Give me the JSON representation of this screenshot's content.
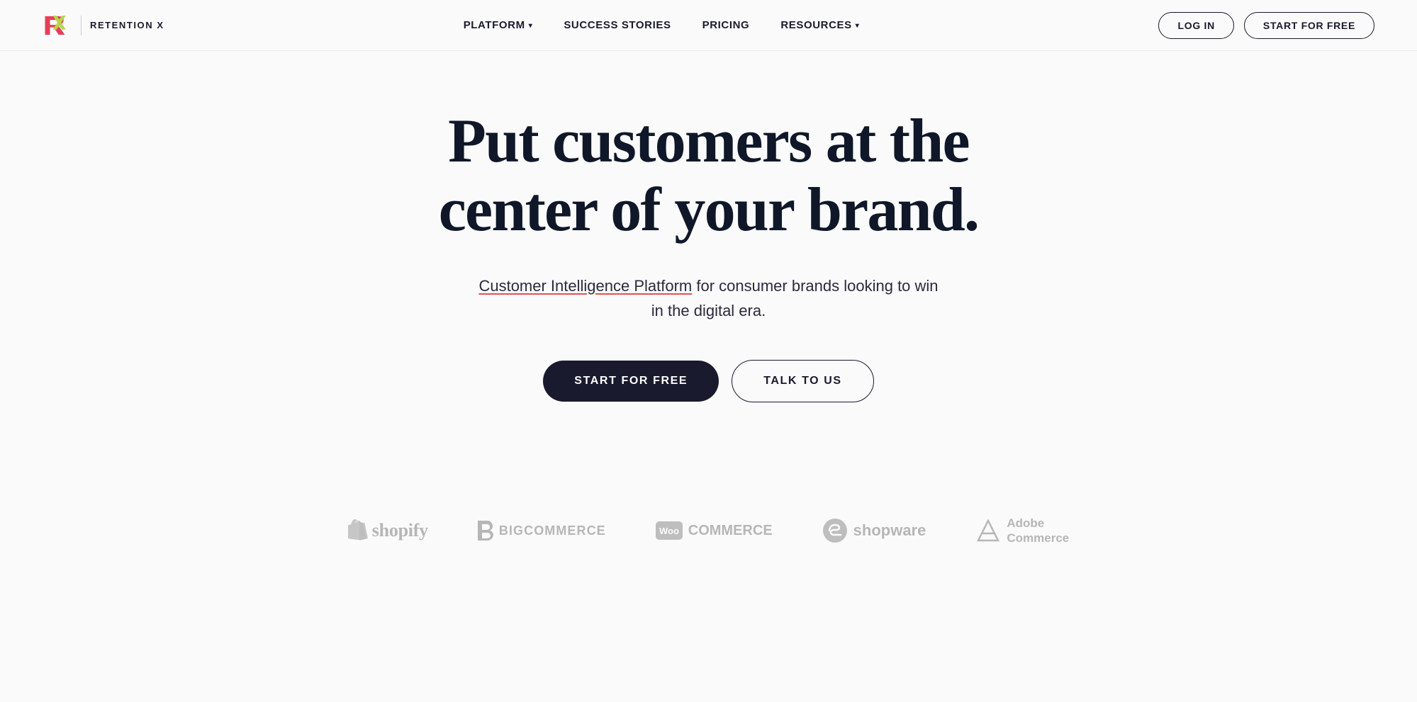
{
  "brand": {
    "logo_text": "RETENTION X",
    "logo_alt": "RX logo"
  },
  "nav": {
    "items": [
      {
        "label": "PLATFORM",
        "has_dropdown": true
      },
      {
        "label": "SUCCESS STORIES",
        "has_dropdown": false
      },
      {
        "label": "PRICING",
        "has_dropdown": false
      },
      {
        "label": "RESOURCES",
        "has_dropdown": true
      }
    ],
    "login_label": "LOG IN",
    "start_free_label": "START FOR FREE"
  },
  "hero": {
    "title_line1": "Put customers at the",
    "title_line2": "center of your brand.",
    "subtitle_link": "Customer Intelligence Platform",
    "subtitle_rest": " for consumer brands looking to win in the digital era.",
    "btn_start": "START FOR FREE",
    "btn_talk": "TALK TO US"
  },
  "partners": [
    {
      "name": "Shopify",
      "id": "shopify"
    },
    {
      "name": "BigCommerce",
      "id": "bigcommerce"
    },
    {
      "name": "WooCommerce",
      "id": "woocommerce"
    },
    {
      "name": "Shopware",
      "id": "shopware"
    },
    {
      "name": "Adobe Commerce",
      "id": "adobe"
    }
  ],
  "colors": {
    "dark": "#0f1729",
    "accent_underline": "#e05252",
    "btn_primary_bg": "#1a1a2e"
  }
}
